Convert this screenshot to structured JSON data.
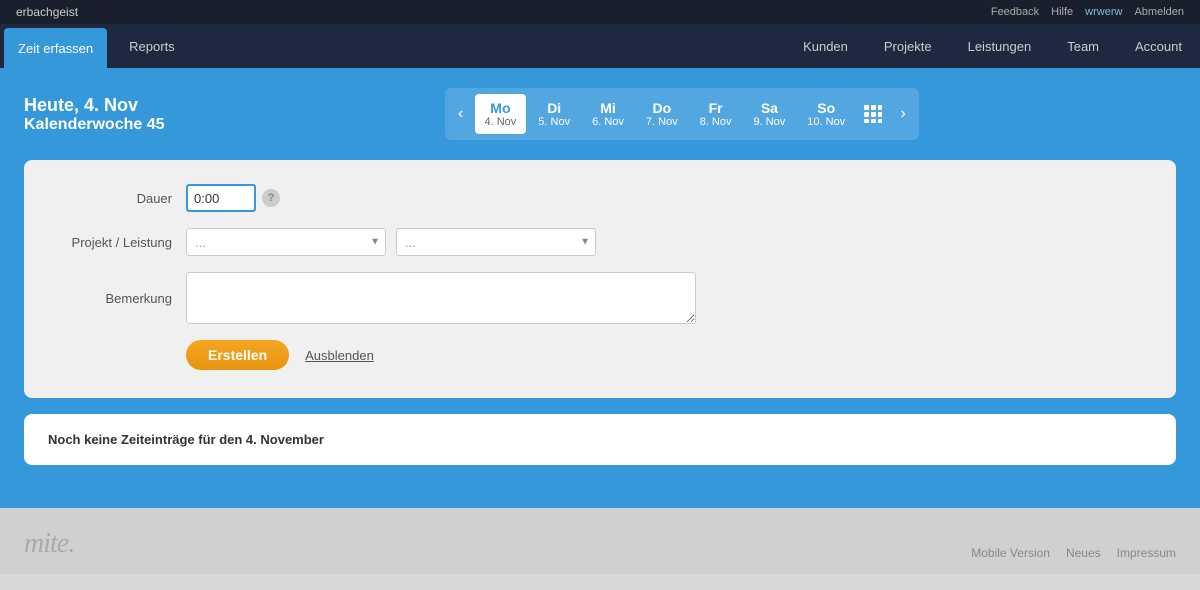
{
  "topbar": {
    "brand": "erbachgeist",
    "links": {
      "feedback": "Feedback",
      "hilfe": "Hilfe",
      "username": "wrwerw",
      "abmelden": "Abmelden"
    }
  },
  "navbar": {
    "left_tabs": [
      {
        "id": "zeit-erfassen",
        "label": "Zeit erfassen",
        "active": true
      },
      {
        "id": "reports",
        "label": "Reports",
        "active": false
      }
    ],
    "right_tabs": [
      {
        "id": "kunden",
        "label": "Kunden",
        "active": false
      },
      {
        "id": "projekte",
        "label": "Projekte",
        "active": false
      },
      {
        "id": "leistungen",
        "label": "Leistungen",
        "active": false
      },
      {
        "id": "team",
        "label": "Team",
        "active": false
      },
      {
        "id": "account",
        "label": "Account",
        "active": false
      }
    ]
  },
  "date_header": {
    "today_label": "Heute, 4. Nov",
    "kw_label": "Kalenderwoche 45"
  },
  "week_nav": {
    "days": [
      {
        "id": "mo",
        "name": "Mo",
        "date": "4. Nov",
        "active": true
      },
      {
        "id": "di",
        "name": "Di",
        "date": "5. Nov",
        "active": false
      },
      {
        "id": "mi",
        "name": "Mi",
        "date": "6. Nov",
        "active": false
      },
      {
        "id": "do",
        "name": "Do",
        "date": "7. Nov",
        "active": false
      },
      {
        "id": "fr",
        "name": "Fr",
        "date": "8. Nov",
        "active": false
      },
      {
        "id": "sa",
        "name": "Sa",
        "date": "9. Nov",
        "active": false
      },
      {
        "id": "so",
        "name": "So",
        "date": "10. Nov",
        "active": false
      }
    ]
  },
  "form": {
    "dauer_label": "Dauer",
    "dauer_value": "0:00",
    "projekt_label": "Projekt / Leistung",
    "projekt_placeholder": "...",
    "leistung_placeholder": "...",
    "bemerkung_label": "Bemerkung",
    "bemerkung_placeholder": "",
    "btn_create": "Erstellen",
    "btn_hide": "Ausblenden"
  },
  "no_entries": {
    "text": "Noch keine Zeiteinträge für den 4. November"
  },
  "footer": {
    "logo": "mite.",
    "links": [
      {
        "id": "mobile",
        "label": "Mobile Version"
      },
      {
        "id": "neues",
        "label": "Neues"
      },
      {
        "id": "impressum",
        "label": "Impressum"
      }
    ]
  }
}
